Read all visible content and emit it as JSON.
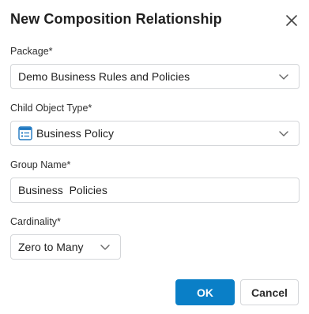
{
  "dialog": {
    "title": "New Composition Relationship",
    "close_icon": "close-icon"
  },
  "package": {
    "label": "Package*",
    "value": "Demo Business Rules and Policies",
    "icon": "chevron-down-icon"
  },
  "child_object_type": {
    "label": "Child Object Type*",
    "value": "Business Policy",
    "type_icon": "business-policy-icon",
    "icon": "chevron-down-icon"
  },
  "group_name": {
    "label": "Group Name*",
    "value": "Business  Policies"
  },
  "cardinality": {
    "label": "Cardinality*",
    "value": "Zero to Many",
    "icon": "chevron-down-icon"
  },
  "buttons": {
    "ok_label": "OK",
    "cancel_label": "Cancel"
  },
  "colors": {
    "primary": "#0a7fc7",
    "border": "#d4d6d9",
    "icon_blue": "#1f78c1"
  }
}
